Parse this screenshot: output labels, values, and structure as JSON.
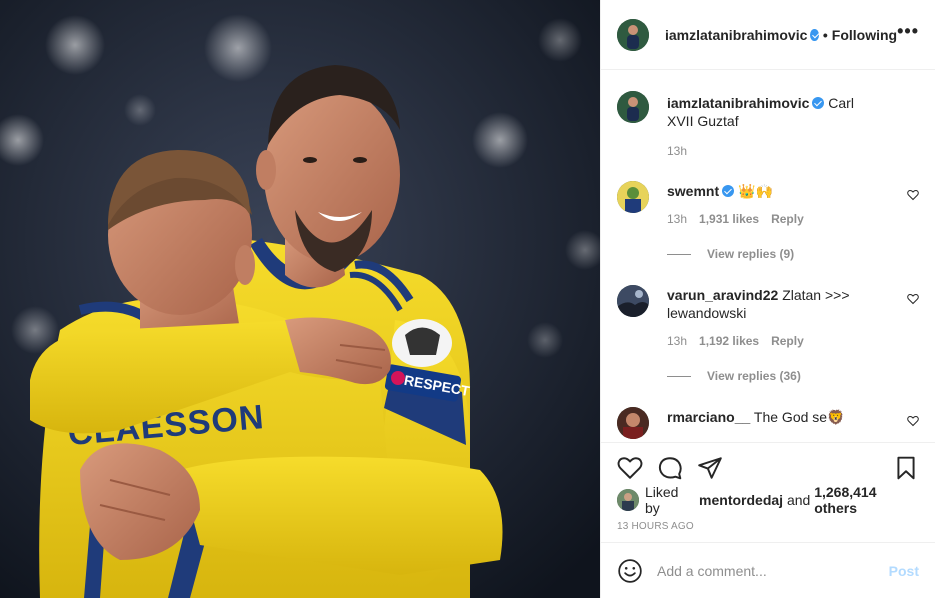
{
  "post": {
    "username": "iamzlatanibrahimovic",
    "separator": "•",
    "follow_label": "Following",
    "more_label": "•••"
  },
  "caption": {
    "username": "iamzlatanibrahimovic",
    "text": "Carl XVII Guztaf",
    "time": "13h"
  },
  "comments": [
    {
      "username": "swemnt",
      "verified": true,
      "text": "👑🙌",
      "time": "13h",
      "likes": "1,931 likes",
      "reply": "Reply",
      "view_replies": "View replies (9)"
    },
    {
      "username": "varun_aravind22",
      "verified": false,
      "text": "Zlatan >>> lewandowski",
      "time": "13h",
      "likes": "1,192 likes",
      "reply": "Reply",
      "view_replies": "View replies (36)"
    },
    {
      "username": "rmarciano__",
      "verified": false,
      "text": "The God se🦁",
      "time": "",
      "likes": "",
      "reply": "",
      "view_replies": ""
    }
  ],
  "likes_line": {
    "prefix": "Liked by",
    "user": "mentordedaj",
    "and": "and",
    "count": "1,268,414 others"
  },
  "timestamp": "13 HOURS AGO",
  "add_comment": {
    "placeholder": "Add a comment...",
    "post_label": "Post"
  },
  "photo": {
    "jersey_text": "CLAESSON",
    "armband_text": "RESPECT"
  },
  "colors": {
    "verified": "#3897f0",
    "muted": "#8e8e8e",
    "post_disabled": "#b3dbff",
    "jersey_yellow": "#f2d21e",
    "jersey_blue": "#1f3b7a"
  },
  "icons": [
    "heart-icon",
    "comment-icon",
    "share-icon",
    "bookmark-icon",
    "smiley-icon",
    "verified-badge-icon",
    "more-options-icon"
  ]
}
